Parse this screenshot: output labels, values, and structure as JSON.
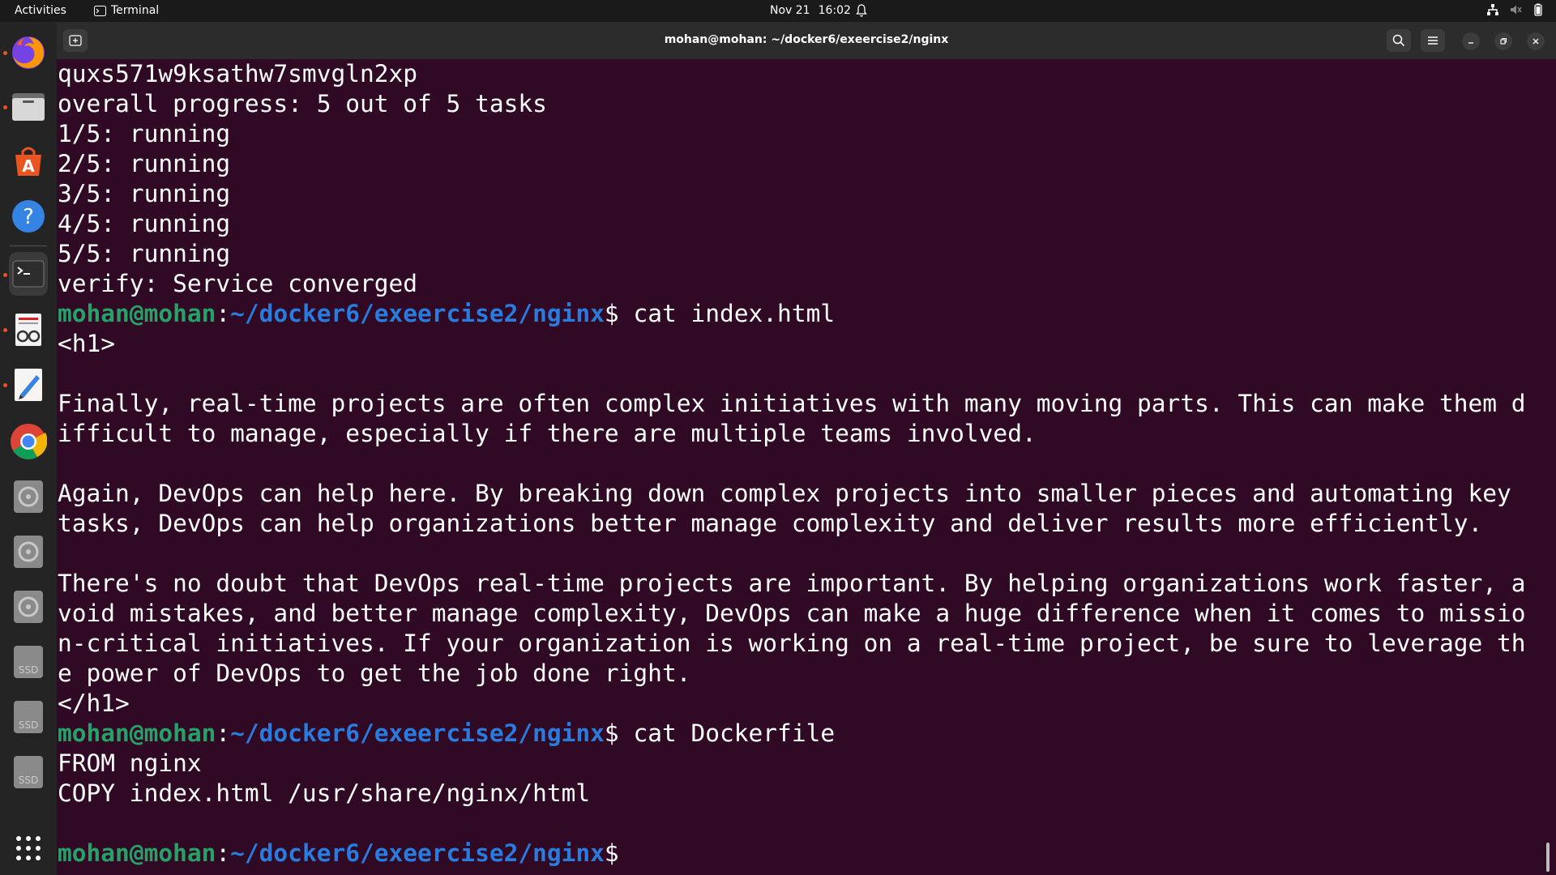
{
  "topbar": {
    "activities": "Activities",
    "app_name": "Terminal",
    "date": "Nov 21",
    "time": "16:02"
  },
  "window": {
    "title": "mohan@mohan: ~/docker6/exeercise2/nginx"
  },
  "prompt": {
    "user": "mohan@mohan",
    "path": "~/docker6/exeercise2/nginx",
    "symbol": "$"
  },
  "terminal": {
    "lines": [
      "quxs571w9ksathw7smvgln2xp",
      "overall progress: 5 out of 5 tasks",
      "1/5: running",
      "2/5: running",
      "3/5: running",
      "4/5: running",
      "5/5: running",
      "verify: Service converged"
    ],
    "cmd1": " cat index.html",
    "html_lines": [
      "<h1>",
      "",
      "Finally, real-time projects are often complex initiatives with many moving parts. This can make them d",
      "ifficult to manage, especially if there are multiple teams involved.",
      "",
      "Again, DevOps can help here. By breaking down complex projects into smaller pieces and automating key",
      "tasks, DevOps can help organizations better manage complexity and deliver results more efficiently.",
      "",
      "There's no doubt that DevOps real-time projects are important. By helping organizations work faster, a",
      "void mistakes, and better manage complexity, DevOps can make a huge difference when it comes to missio",
      "n-critical initiatives. If your organization is working on a real-time project, be sure to leverage th",
      "e power of DevOps to get the job done right.",
      "</h1>"
    ],
    "cmd2": " cat Dockerfile",
    "docker_lines": [
      "FROM nginx",
      "COPY index.html /usr/share/nginx/html",
      ""
    ]
  },
  "dock": {
    "items": [
      {
        "icon": "firefox-icon"
      },
      {
        "icon": "files-icon"
      },
      {
        "icon": "app-center-icon"
      },
      {
        "icon": "help-icon"
      },
      {
        "icon": "terminal-icon"
      },
      {
        "icon": "document-viewer-icon"
      },
      {
        "icon": "text-editor-icon"
      },
      {
        "icon": "chrome-icon"
      },
      {
        "icon": "disk-icon"
      },
      {
        "icon": "disk-icon"
      },
      {
        "icon": "disk-icon"
      },
      {
        "icon": "ssd-icon",
        "label": "SSD"
      },
      {
        "icon": "ssd-icon",
        "label": "SSD"
      },
      {
        "icon": "ssd-icon",
        "label": "SSD"
      }
    ]
  },
  "colors": {
    "terminal_bg": "#300a24",
    "prompt_user": "#26a269",
    "prompt_path": "#2a7bde",
    "accent": "#e95420"
  }
}
